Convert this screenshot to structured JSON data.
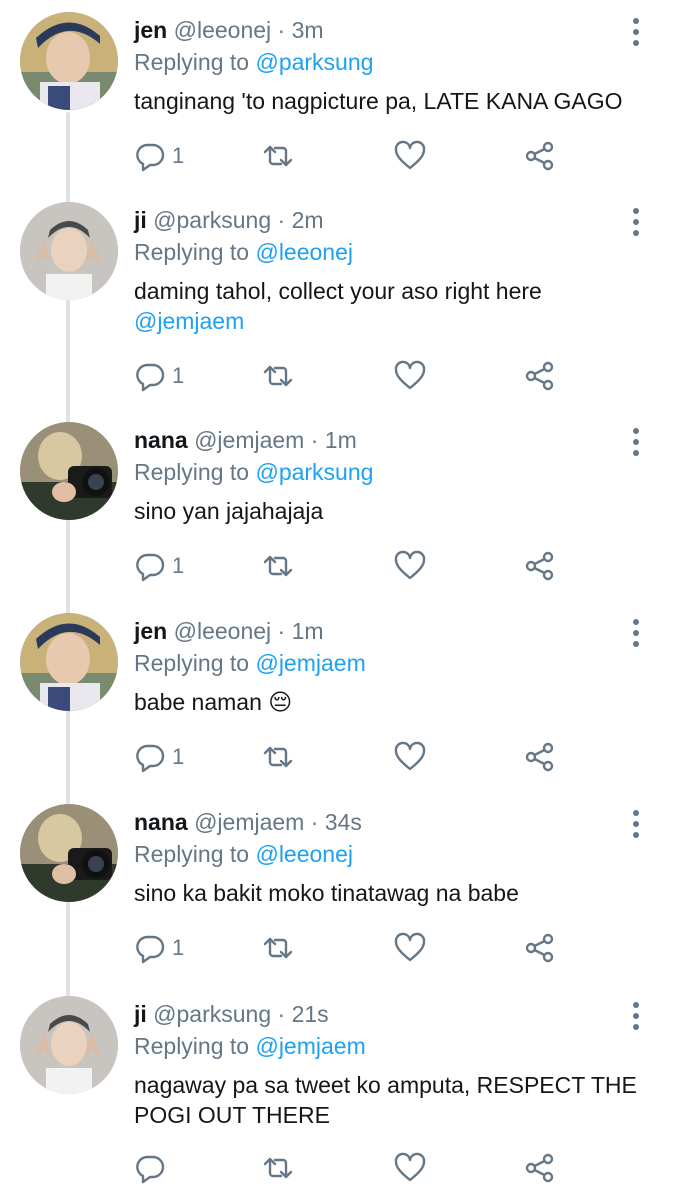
{
  "tweets": [
    {
      "name": "jen",
      "handle": "@leeonej",
      "sep": "·",
      "time": "3m",
      "replying_label": "Replying to",
      "replying_to": "@parksung",
      "text": "tanginang 'to nagpicture pa, LATE KANA GAGO",
      "text_mention": "",
      "reply_count": "1",
      "avatar": "jen-avatar"
    },
    {
      "name": "ji",
      "handle": "@parksung",
      "sep": "·",
      "time": "2m",
      "replying_label": "Replying to",
      "replying_to": "@leeonej",
      "text": "daming tahol, collect your aso right here",
      "text_mention": "@jemjaem",
      "reply_count": "1",
      "avatar": "ji-avatar"
    },
    {
      "name": "nana",
      "handle": "@jemjaem",
      "sep": "·",
      "time": "1m",
      "replying_label": "Replying to",
      "replying_to": "@parksung",
      "text": "sino yan jajahajaja",
      "text_mention": "",
      "reply_count": "1",
      "avatar": "nana-avatar"
    },
    {
      "name": "jen",
      "handle": "@leeonej",
      "sep": "·",
      "time": "1m",
      "replying_label": "Replying to",
      "replying_to": "@jemjaem",
      "text": "babe naman 😔",
      "text_mention": "",
      "reply_count": "1",
      "avatar": "jen-avatar"
    },
    {
      "name": "nana",
      "handle": "@jemjaem",
      "sep": "·",
      "time": "34s",
      "replying_label": "Replying to",
      "replying_to": "@leeonej",
      "text": "sino ka bakit moko tinatawag na babe",
      "text_mention": "",
      "reply_count": "1",
      "avatar": "nana-avatar"
    },
    {
      "name": "ji",
      "handle": "@parksung",
      "sep": "·",
      "time": "21s",
      "replying_label": "Replying to",
      "replying_to": "@jemjaem",
      "text": "nagaway pa sa tweet ko amputa, RESPECT THE POGI OUT THERE",
      "text_mention": "",
      "reply_count": "",
      "avatar": "ji-avatar"
    }
  ],
  "icons": {
    "reply": "reply-icon",
    "retweet": "retweet-icon",
    "like": "heart-icon",
    "share": "share-icon",
    "more": "more-options-icon"
  },
  "colors": {
    "name": "#14171a",
    "secondary": "#657786",
    "mention": "#1da1f2",
    "thread_line": "#dfe3e6",
    "background": "#ffffff"
  }
}
